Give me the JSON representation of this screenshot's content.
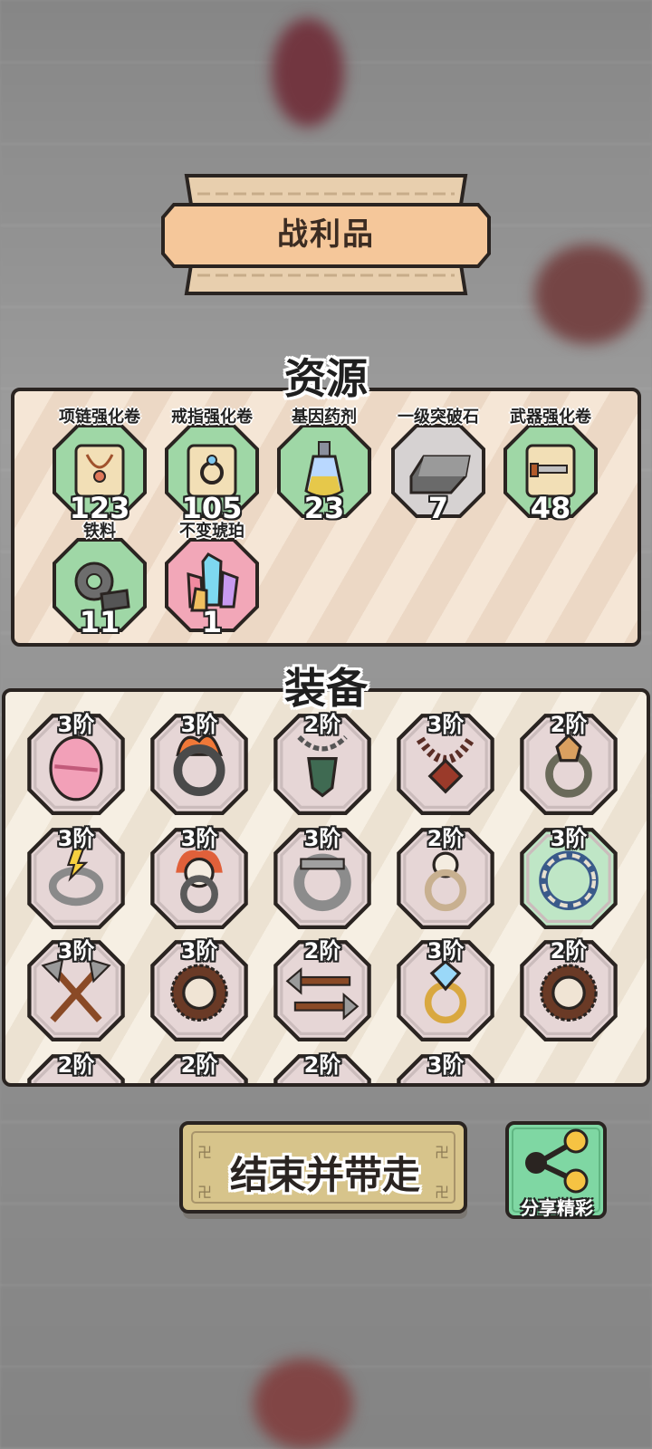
{
  "banner": {
    "title": "战利品"
  },
  "resources": {
    "title": "资源",
    "items": [
      {
        "label": "项链强化卷",
        "count": "123",
        "icon": "necklace-scroll-icon",
        "bg": "#9fd7a6"
      },
      {
        "label": "戒指强化卷",
        "count": "105",
        "icon": "ring-scroll-icon",
        "bg": "#9fd7a6"
      },
      {
        "label": "基因药剂",
        "count": "23",
        "icon": "potion-bottle-icon",
        "bg": "#9fd7a6"
      },
      {
        "label": "一级突破石",
        "count": "7",
        "icon": "iron-ingot-icon",
        "bg": "#d6d2d2"
      },
      {
        "label": "武器强化卷",
        "count": "48",
        "icon": "weapon-scroll-icon",
        "bg": "#9fd7a6"
      },
      {
        "label": "铁料",
        "count": "11",
        "icon": "gear-ore-icon",
        "bg": "#9fd7a6"
      },
      {
        "label": "不变琥珀",
        "count": "1",
        "icon": "crystal-cluster-icon",
        "bg": "#f2a7b8"
      }
    ]
  },
  "equipment": {
    "title": "装备",
    "items": [
      {
        "tier": "3阶",
        "icon": "pink-egg-icon"
      },
      {
        "tier": "3阶",
        "icon": "flame-ring-icon"
      },
      {
        "tier": "2阶",
        "icon": "chain-pendant-icon"
      },
      {
        "tier": "3阶",
        "icon": "bead-necklace-icon"
      },
      {
        "tier": "2阶",
        "icon": "gem-ring-icon"
      },
      {
        "tier": "3阶",
        "icon": "lightning-ring-icon"
      },
      {
        "tier": "3阶",
        "icon": "skull-flame-ring-icon"
      },
      {
        "tier": "3阶",
        "icon": "iron-band-ring-icon"
      },
      {
        "tier": "2阶",
        "icon": "skull-bone-ring-icon"
      },
      {
        "tier": "3阶",
        "icon": "bone-chain-ring-icon"
      },
      {
        "tier": "3阶",
        "icon": "crossed-axes-icon"
      },
      {
        "tier": "3阶",
        "icon": "spiked-ring-icon"
      },
      {
        "tier": "2阶",
        "icon": "double-axe-icon"
      },
      {
        "tier": "3阶",
        "icon": "diamond-ring-icon"
      },
      {
        "tier": "2阶",
        "icon": "spiked-ring-icon"
      },
      {
        "tier": "2阶",
        "icon": "equipment-icon"
      },
      {
        "tier": "2阶",
        "icon": "equipment-icon"
      },
      {
        "tier": "2阶",
        "icon": "equipment-icon"
      },
      {
        "tier": "3阶",
        "icon": "equipment-icon"
      }
    ]
  },
  "buttons": {
    "end_label": "结束并带走",
    "share_label": "分享精彩"
  },
  "colors": {
    "panel_border": "#2a2421",
    "banner_fill": "#f5c79a",
    "button_fill": "#d7c48b",
    "share_fill": "#7fd7a3",
    "share_node": "#f6c343"
  }
}
